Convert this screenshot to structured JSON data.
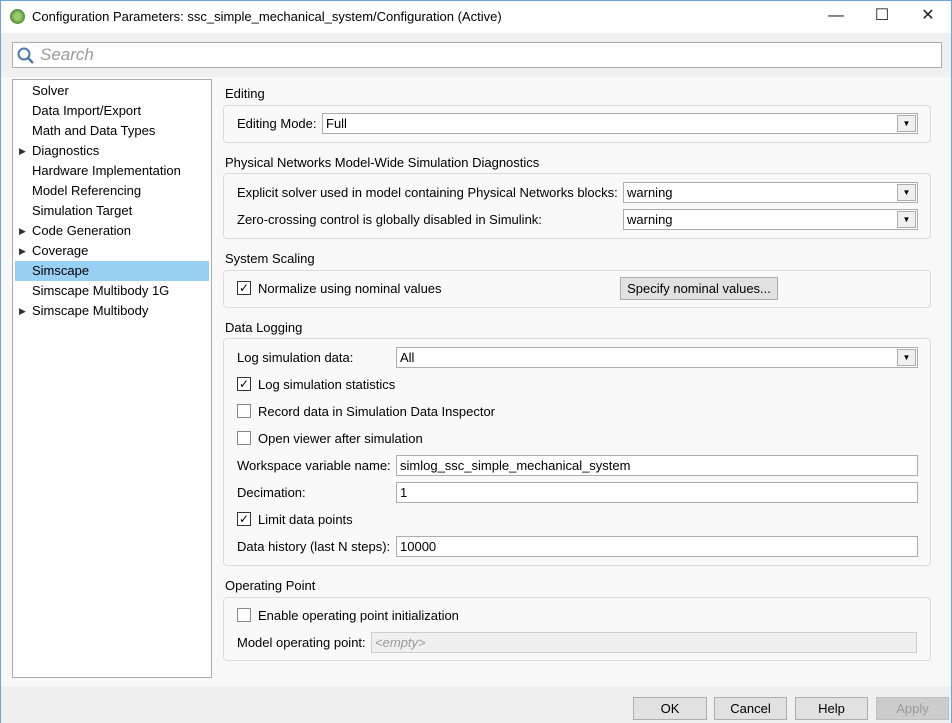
{
  "window": {
    "title": "Configuration Parameters: ssc_simple_mechanical_system/Configuration (Active)",
    "minimize": "—",
    "maximize": "☐",
    "close": "✕"
  },
  "search": {
    "placeholder": "Search"
  },
  "tree": [
    {
      "label": "Solver",
      "expandable": false
    },
    {
      "label": "Data Import/Export",
      "expandable": false
    },
    {
      "label": "Math and Data Types",
      "expandable": false
    },
    {
      "label": "Diagnostics",
      "expandable": true
    },
    {
      "label": "Hardware Implementation",
      "expandable": false
    },
    {
      "label": "Model Referencing",
      "expandable": false
    },
    {
      "label": "Simulation Target",
      "expandable": false
    },
    {
      "label": "Code Generation",
      "expandable": true
    },
    {
      "label": "Coverage",
      "expandable": true
    },
    {
      "label": "Simscape",
      "expandable": false,
      "selected": true
    },
    {
      "label": "Simscape Multibody 1G",
      "expandable": false
    },
    {
      "label": "Simscape Multibody",
      "expandable": true
    }
  ],
  "editing": {
    "header": "Editing",
    "mode_label": "Editing Mode:",
    "mode_value": "Full"
  },
  "diagnostics": {
    "header": "Physical Networks Model-Wide Simulation Diagnostics",
    "explicit_label": "Explicit solver used in model containing Physical Networks blocks:",
    "explicit_value": "warning",
    "zc_label": "Zero-crossing control is globally disabled in Simulink:",
    "zc_value": "warning"
  },
  "scaling": {
    "header": "System Scaling",
    "normalize_label": "Normalize using nominal values",
    "normalize_checked": true,
    "specify_button": "Specify nominal values..."
  },
  "logging": {
    "header": "Data Logging",
    "log_label": "Log simulation data:",
    "log_value": "All",
    "stats_label": "Log simulation statistics",
    "stats_checked": true,
    "sdi_label": "Record data in Simulation Data Inspector",
    "sdi_checked": false,
    "viewer_label": "Open viewer after simulation",
    "viewer_checked": false,
    "ws_label": "Workspace variable name:",
    "ws_value": "simlog_ssc_simple_mechanical_system",
    "dec_label": "Decimation:",
    "dec_value": "1",
    "limit_label": "Limit data points",
    "limit_checked": true,
    "hist_label": "Data history (last N steps):",
    "hist_value": "10000"
  },
  "op": {
    "header": "Operating Point",
    "enable_label": "Enable operating point initialization",
    "enable_checked": false,
    "model_label": "Model operating point:",
    "model_placeholder": "<empty>"
  },
  "buttons": {
    "ok": "OK",
    "cancel": "Cancel",
    "help": "Help",
    "apply": "Apply"
  },
  "check": "✓",
  "dd_arrow": "▼",
  "tree_arrow": "▶"
}
